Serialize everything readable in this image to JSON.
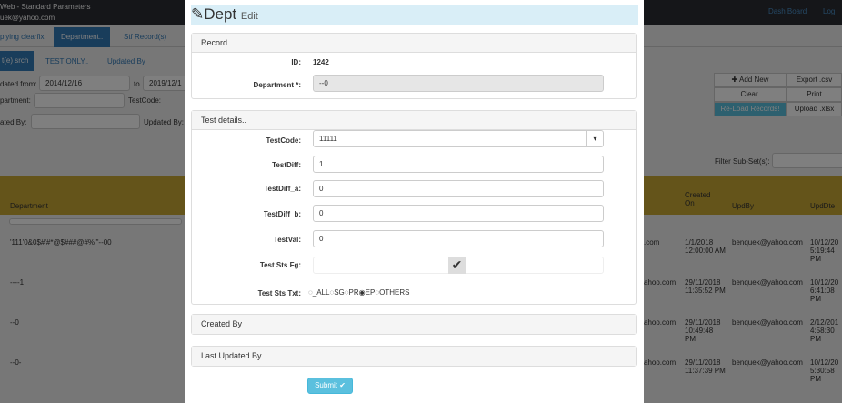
{
  "background": {
    "header": {
      "title": "Web - Standard Parameters",
      "user": "uek@yahoo.com",
      "dashboard": "Dash Board",
      "logout": "Log"
    },
    "tabs": [
      "plying clearfix",
      "Department..",
      "Stf Record(s)"
    ],
    "subtabs": [
      "t(e) srch",
      "TEST ONLY..",
      "Updated By"
    ],
    "filters": {
      "updated_from_label": "dated from:",
      "updated_from": "2014/12/16",
      "to_label": "to",
      "updated_to": "2019/12/1",
      "department_label": "partment:",
      "testcode_label": "TestCode:",
      "updated_by_label": "ated By:",
      "updated_by2_label": "Updated By:"
    },
    "buttons": {
      "add_new": "✚ Add New",
      "export": "Export .csv",
      "clear": "Clear.",
      "print": "Print",
      "reload": "Re-Load Records!",
      "upload": "Upload .xlsx"
    },
    "filter_subset_label": "Filter Sub-Set(s):",
    "columns": [
      "Department",
      "Created On",
      "UpdBy",
      "UpdDte"
    ],
    "rows": [
      {
        "dept": "'111'0&0$#'#*@$###@#%'\"--00",
        "created_by": ".com",
        "created": "1/1/2018 12:00:00 AM",
        "updby": "benquek@yahoo.com",
        "upddte": "10/12/20 5:19:44 PM"
      },
      {
        "dept": "----1",
        "created_by": "ahoo.com",
        "created": "29/11/2018 11:35:52 PM",
        "updby": "benquek@yahoo.com",
        "upddte": "10/12/20 6:41:08 PM"
      },
      {
        "dept": "--0",
        "created_by": "ahoo.com",
        "created": "29/11/2018 10:49:48 PM",
        "updby": "benquek@yahoo.com",
        "upddte": "2/12/201 4:58:30 PM"
      },
      {
        "dept": "--0-",
        "created_by": "ahoo.com",
        "created": "29/11/2018 11:37:39 PM",
        "updby": "benquek@yahoo.com",
        "upddte": "10/12/20 5:30:58 PM"
      }
    ]
  },
  "modal": {
    "title": "Dept",
    "title_suffix": "Edit",
    "icon": "pencil-icon",
    "record": {
      "heading": "Record",
      "id_label": "ID:",
      "id_value": "1242",
      "dept_label": "Department *:",
      "dept_value": "--0"
    },
    "test": {
      "heading": "Test details..",
      "testcode_label": "TestCode:",
      "testcode_value": "11111",
      "testdiff_label": "TestDiff:",
      "testdiff_value": "1",
      "testdiff_a_label": "TestDiff_a:",
      "testdiff_a_value": "0",
      "testdiff_b_label": "TestDiff_b:",
      "testdiff_b_value": "0",
      "testval_label": "TestVal:",
      "testval_value": "0",
      "stsfg_label": "Test Sts Fg:",
      "stsfg_checked": true,
      "ststxt_label": "Test Sts Txt:",
      "ststxt_options": [
        "_ALL",
        "SG",
        "PR",
        "EP",
        "OTHERS"
      ],
      "ststxt_selected": "EP"
    },
    "created_by": "Created By",
    "last_updated_by": "Last Updated By",
    "submit": "Submit ✔"
  }
}
